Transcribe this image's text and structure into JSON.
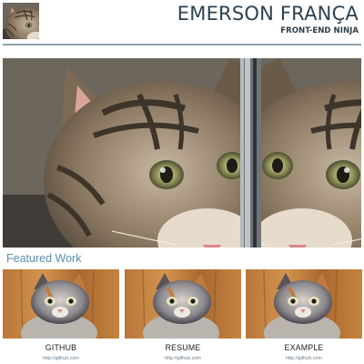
{
  "header": {
    "name": "EMERSON FRANÇA",
    "tagline": "FRONT-END NINJA"
  },
  "featured": {
    "heading": "Featured Work",
    "cards": [
      {
        "title": "GITHUB",
        "link": "http://github.com"
      },
      {
        "title": "RESUME",
        "link": "http://github.com"
      },
      {
        "title": "EXAMPLE",
        "link": "http://github.com"
      }
    ]
  },
  "colors": {
    "name": "#2b4150",
    "accent": "#5b8fb0",
    "rule": "#8fa1ab"
  },
  "icons": {
    "avatar": "kitten-photo",
    "hero": "kitten-photo",
    "thumbnails": "kitten-photo"
  }
}
